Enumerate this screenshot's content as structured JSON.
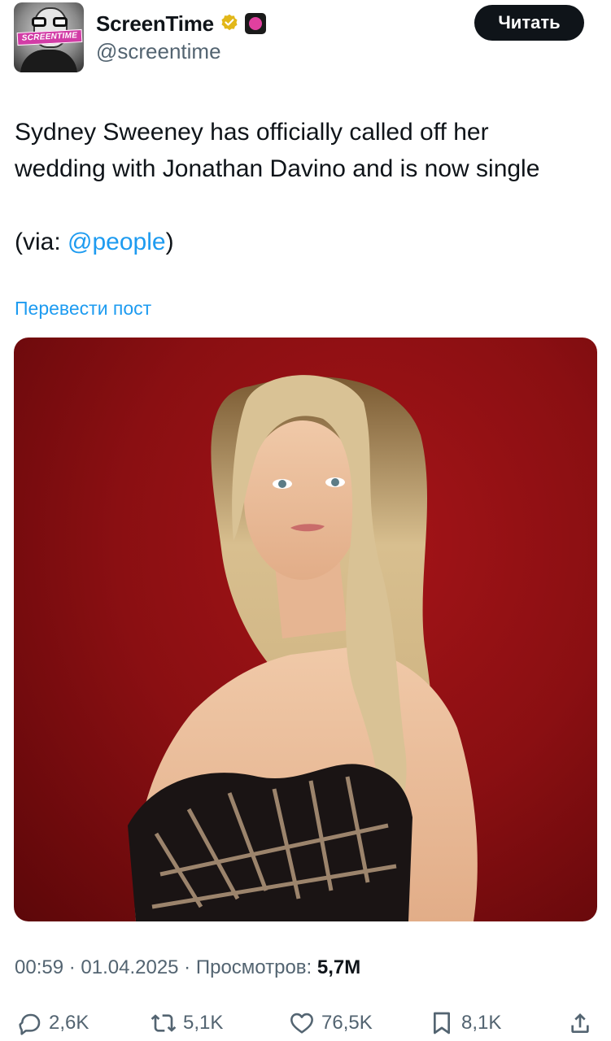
{
  "account": {
    "display_name": "ScreenTime",
    "handle": "@screentime",
    "avatar_label": "SCREENTIME",
    "follow_label": "Читать"
  },
  "tweet": {
    "line1": "Sydney Sweeney has officially called off her",
    "line2": "wedding with Jonathan Davino and is now single",
    "via_prefix": "(via: ",
    "via_mention": "@people",
    "via_suffix": ")",
    "translate_label": "Перевести пост"
  },
  "meta": {
    "time": "00:59",
    "sep1": " · ",
    "date": "01.04.2025",
    "sep2": " · ",
    "views_label": "Просмотров: ",
    "views_value": "5,7M"
  },
  "actions": {
    "replies": "2,6K",
    "reposts": "5,1K",
    "likes": "76,5K",
    "bookmarks": "8,1K"
  },
  "colors": {
    "accent": "#1d9bf0",
    "text": "#0f1419",
    "secondary": "#536471",
    "verified_gold": "#e2b719",
    "photo_bg": "#8a0f12"
  }
}
